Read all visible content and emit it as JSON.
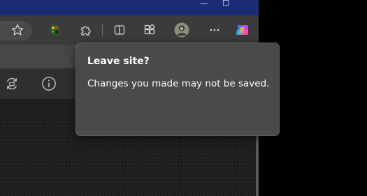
{
  "window": {
    "minimize_glyph": "—",
    "maximize_glyph": "☐"
  },
  "toolbar": {
    "icons": [
      "favorite-star-icon",
      "color-palette-extension-icon",
      "extensions-puzzle-icon",
      "split-screen-icon",
      "collections-icon",
      "profile-avatar",
      "more-menu-icon",
      "copilot-icon"
    ]
  },
  "page_icons": [
    "refresh-sync-icon",
    "info-icon"
  ],
  "dialog": {
    "title": "Leave site?",
    "message": "Changes you made may not be saved."
  },
  "colors": {
    "titlebar": "#1a2d73",
    "toolbar": "#3b3b3b",
    "dialog_bg": "#4a4a4a",
    "dialog_text": "#ffffff"
  }
}
